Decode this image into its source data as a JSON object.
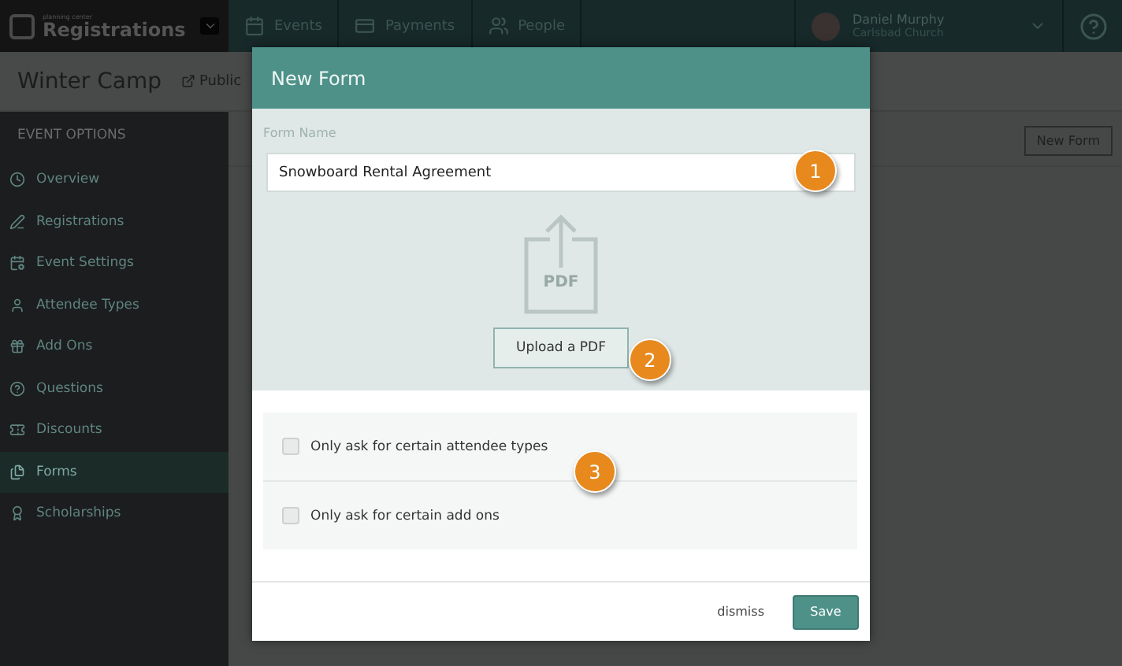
{
  "topbar": {
    "logo_small": "planning center",
    "logo": "Registrations",
    "nav": [
      {
        "label": "Events"
      },
      {
        "label": "Payments"
      },
      {
        "label": "People"
      }
    ],
    "user": {
      "name": "Daniel Murphy",
      "org": "Carlsbad Church"
    }
  },
  "page_header": {
    "title": "Winter Camp",
    "link": "Public"
  },
  "sidebar": {
    "heading": "EVENT OPTIONS",
    "items": [
      {
        "label": "Overview",
        "selected": false
      },
      {
        "label": "Registrations",
        "selected": false
      },
      {
        "label": "Event Settings",
        "selected": false
      },
      {
        "label": "Attendee Types",
        "selected": false
      },
      {
        "label": "Add Ons",
        "selected": false
      },
      {
        "label": "Questions",
        "selected": false
      },
      {
        "label": "Discounts",
        "selected": false
      },
      {
        "label": "Forms",
        "selected": true
      },
      {
        "label": "Scholarships",
        "selected": false
      }
    ]
  },
  "content": {
    "button": "New Form"
  },
  "modal": {
    "title": "New Form",
    "field_label": "Form Name",
    "field_value": "Snowboard Rental Agreement",
    "pdf_label": "PDF",
    "upload_button": "Upload a PDF",
    "options": [
      {
        "label": "Only ask for certain attendee types",
        "checked": false
      },
      {
        "label": "Only ask for certain add ons",
        "checked": false
      }
    ],
    "dismiss": "dismiss",
    "save": "Save"
  },
  "callouts": [
    "1",
    "2",
    "3"
  ]
}
